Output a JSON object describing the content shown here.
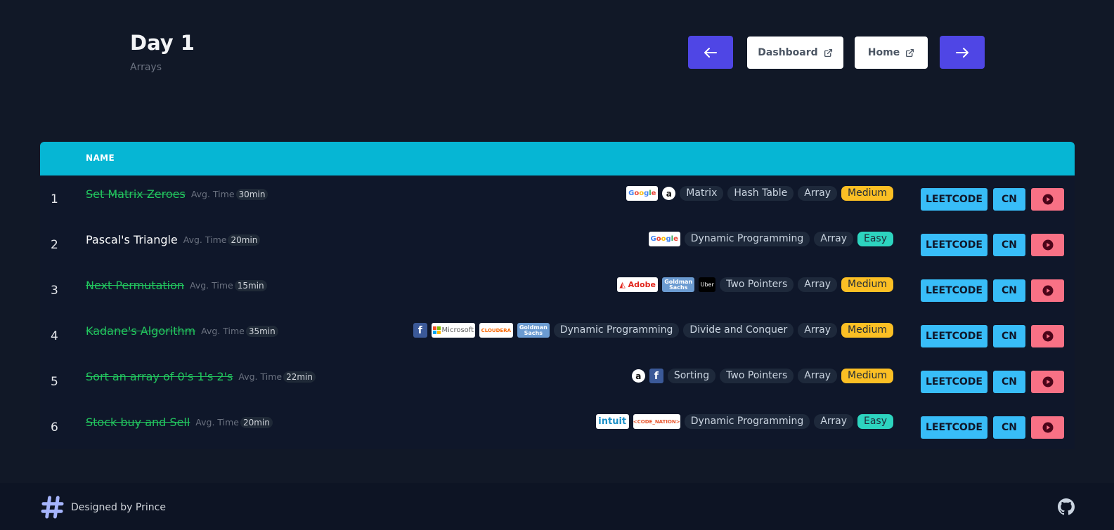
{
  "page": {
    "title": "Day 1",
    "subtitle": "Arrays"
  },
  "nav": {
    "prev_icon": "arrow-left-icon",
    "dashboard_label": "Dashboard",
    "home_label": "Home",
    "next_icon": "arrow-right-icon",
    "external_icon": "external-link-icon"
  },
  "table": {
    "header_name": "NAME",
    "avg_time_label": "Avg. Time",
    "leetcode_label": "LEETCODE",
    "cn_label": "CN",
    "video_icon": "play-icon",
    "rows": [
      {
        "index": "1",
        "name": "Set Matrix Zeroes",
        "done": true,
        "time": "30min",
        "companies": [
          "Google",
          "Amazon"
        ],
        "tags": [
          "Matrix",
          "Hash Table",
          "Array"
        ],
        "difficulty": "Medium"
      },
      {
        "index": "2",
        "name": "Pascal's Triangle",
        "done": false,
        "time": "20min",
        "companies": [
          "Google"
        ],
        "tags": [
          "Dynamic Programming",
          "Array"
        ],
        "difficulty": "Easy"
      },
      {
        "index": "3",
        "name": "Next Permutation",
        "done": true,
        "time": "15min",
        "companies": [
          "Adobe",
          "Goldman Sachs",
          "Uber"
        ],
        "tags": [
          "Two Pointers",
          "Array"
        ],
        "difficulty": "Medium"
      },
      {
        "index": "4",
        "name": "Kadane's Algorithm",
        "done": true,
        "time": "35min",
        "companies": [
          "Facebook",
          "Microsoft",
          "CLOUDERA",
          "Goldman Sachs"
        ],
        "tags": [
          "Dynamic Programming",
          "Divide and Conquer",
          "Array"
        ],
        "difficulty": "Medium"
      },
      {
        "index": "5",
        "name": "Sort an array of 0's 1's 2's",
        "done": true,
        "time": "22min",
        "companies": [
          "Amazon",
          "Facebook"
        ],
        "tags": [
          "Sorting",
          "Two Pointers",
          "Array"
        ],
        "difficulty": "Medium"
      },
      {
        "index": "6",
        "name": "Stock buy and Sell",
        "done": true,
        "time": "20min",
        "companies": [
          "intuit",
          "CODE_NATION"
        ],
        "tags": [
          "Dynamic Programming",
          "Array"
        ],
        "difficulty": "Easy"
      }
    ]
  },
  "footer": {
    "credit": "Designed by Prince",
    "logo_icon": "hash-logo-icon",
    "github_icon": "github-icon"
  },
  "colors": {
    "background": "#111827",
    "header_bar": "#06b6d4",
    "accent": "#4f46e5",
    "done": "#22c55e",
    "medium": "#fbbf24",
    "easy": "#2dd4bf",
    "leetcode_btn": "#38bdf8",
    "video_btn": "#f87185"
  }
}
